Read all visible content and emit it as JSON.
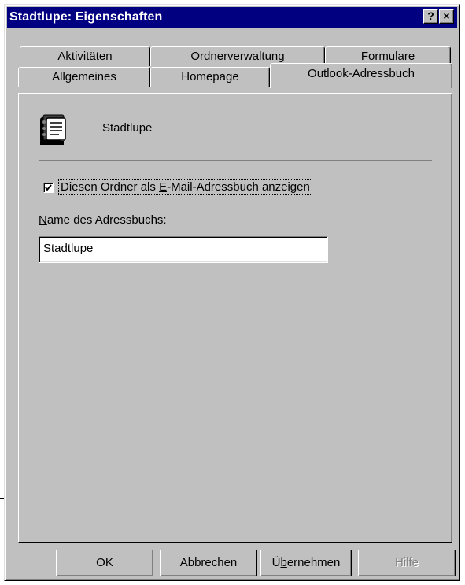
{
  "window": {
    "title": "Stadtlupe: Eigenschaften",
    "help_button": "?",
    "close_button": "×"
  },
  "tabs": {
    "row_back": [
      "Aktivitäten",
      "Ordnerverwaltung",
      "Formulare"
    ],
    "row_front": [
      "Allgemeines",
      "Homepage",
      "Outlook-Adressbuch"
    ],
    "active": "Outlook-Adressbuch"
  },
  "panel": {
    "folder_name": "Stadtlupe",
    "checkbox": {
      "checked": true,
      "label_pre": "Diesen Ordner als ",
      "label_accel": "E",
      "label_post": "-Mail-Adressbuch anzeigen"
    },
    "field": {
      "label_accel": "N",
      "label_rest": "ame des Adressbuchs:",
      "value": "Stadtlupe"
    }
  },
  "buttons": {
    "ok": "OK",
    "cancel": "Abbrechen",
    "apply_pre": "Ü",
    "apply_accel": "b",
    "apply_post": "ernehmen",
    "help": "Hilfe"
  },
  "icons": {
    "folder_icon": "address-book-icon",
    "check_icon": "checkmark-icon"
  }
}
